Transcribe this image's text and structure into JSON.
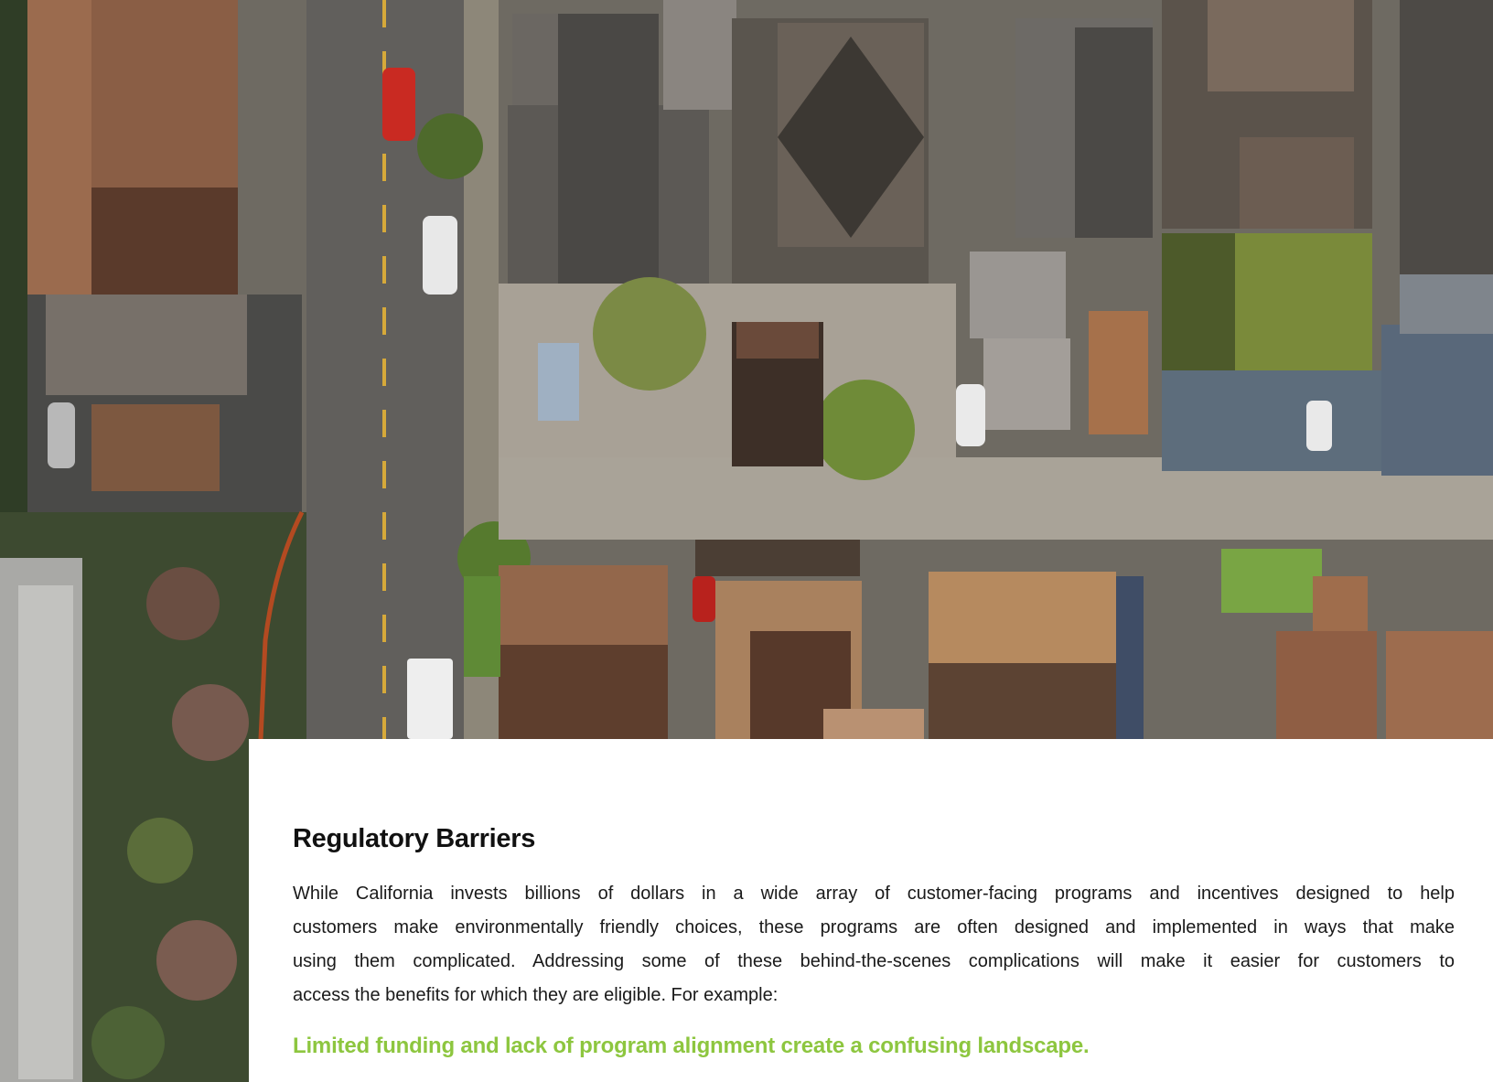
{
  "section": {
    "heading": "Regulatory Barriers",
    "paragraph_lines": [
      "While California invests billions of dollars in a wide array of customer-facing programs and incentives designed to help",
      "customers make environmentally friendly choices, these programs are often designed and implemented in ways that make",
      "using them complicated. Addressing some of these behind-the-scenes complications will make it easier for customers to",
      "access the benefits for which they are eligible. For example:"
    ],
    "callout": "Limited funding and lack of program alignment create a confusing landscape."
  },
  "colors": {
    "callout": "#8dc63f",
    "heading": "#111111",
    "body_text": "#1a1a1a",
    "panel_background": "#ffffff"
  },
  "photo": {
    "icon": "aerial-neighborhood-photo"
  }
}
